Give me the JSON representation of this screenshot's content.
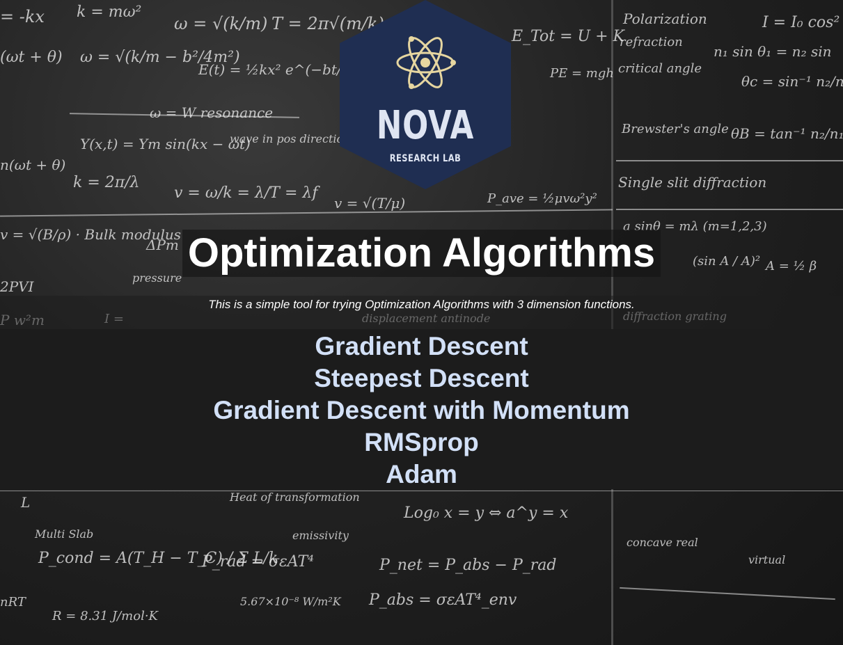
{
  "logo": {
    "name": "NOVA",
    "subtitle": "RESEARCH LAB"
  },
  "title": "Optimization Algorithms",
  "subtitle": "This is a simple tool for trying Optimization Algorithms with 3 dimension functions.",
  "algorithms": [
    "Gradient Descent",
    "Steepest Descent",
    "Gradient Descent with Momentum",
    "RMSprop",
    "Adam"
  ],
  "colors": {
    "logo_hexagon": "#1f2e52",
    "logo_emblem": "#e6d6a0",
    "logo_text": "#dfe5f2",
    "title_text": "#ffffff",
    "algorithm_link": "#d2e0f7",
    "panel_background": "#1c1c1c"
  },
  "icons": [
    "atom-icon"
  ]
}
